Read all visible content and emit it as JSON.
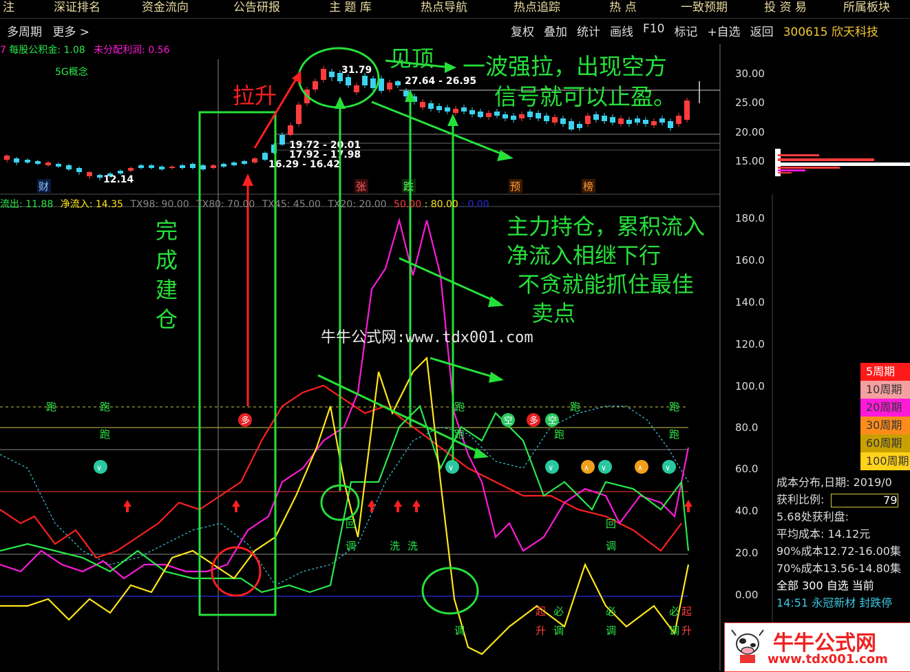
{
  "nav": [
    "注",
    "深证排名",
    "资金流向",
    "公告研报",
    "主 题 库",
    "热点导航",
    "热点追踪",
    "热  点",
    "一致预期",
    "投 资 易",
    "所属板块"
  ],
  "subbar": {
    "period": "多周期",
    "more": "更多 >",
    "tools": [
      "复权",
      "叠加",
      "统计",
      "画线",
      "F10",
      "标记",
      "+自选",
      "返回"
    ],
    "stock": "300615 欣天科技"
  },
  "info": {
    "reserve_label": "每股公积金: 1.08",
    "undist_label": "未分配利润: 0.56",
    "concept": "5G概念"
  },
  "price_axis": [
    "30.00",
    "25.00",
    "20.00",
    "15.00"
  ],
  "price_labels": {
    "high": "31.79",
    "range1": "27.64 - 26.95",
    "range2": "19.72 - 20.01",
    "range3": "17.92 - 17.98",
    "range4": "16.29 - 16.42",
    "low": "12.14"
  },
  "event_tags": [
    "财",
    "张",
    "跌",
    "预",
    "榜"
  ],
  "indicator_line": {
    "a": "流出: 11.88",
    "b": "净流入: 14.35",
    "c": "TX98: 90.00",
    "d": "TX80: 70.00",
    "e": "TX45: 45.00",
    "f": "TX20: 20.00",
    "g": "50.00",
    "h": ": 80.00",
    "i": ": 0.00"
  },
  "ind_axis": [
    "180.0",
    "160.0",
    "140.0",
    "120.0",
    "100.0",
    "80.0",
    "60.0",
    "40.0",
    "20.0",
    "0.00"
  ],
  "legend": [
    {
      "label": "5周期",
      "color": "#ff1a1a"
    },
    {
      "label": "10周期",
      "color": "#f4a0a0"
    },
    {
      "label": "20周期",
      "color": "#ff1ad9"
    },
    {
      "label": "30周期",
      "color": "#ff8c1a"
    },
    {
      "label": "60周期",
      "color": "#c8a000"
    },
    {
      "label": "100周期",
      "color": "#ffd21a"
    }
  ],
  "panel": {
    "title": "成本分布,日期: 2019/0",
    "ratio_label": "获利比例:",
    "ratio_value": "79",
    "line3": "5.68处获利盘:",
    "line4": "平均成本: 14.12元",
    "line5": "90%成本12.72-16.00集",
    "line6": "70%成本13.56-14.80集",
    "line7": "全部 300  自选 当前",
    "line8": "14:51  永冠新材  封跌停"
  },
  "annotations": {
    "lasheng": "拉升",
    "jianding": "见顶",
    "note1": "一波强拉，出现空方",
    "note2": "信号就可以止盈。",
    "jiancang": "完成建仓",
    "note3": "主力持仓，累积流入",
    "note4": "净流入相继下行",
    "note5": "不贪就能抓住最佳",
    "note6": "卖点"
  },
  "signals": {
    "pao": "跑",
    "duo": "多",
    "kong": "空",
    "hui": "回",
    "diao": "调",
    "xi": "洗",
    "qi": "起",
    "sheng": "升",
    "bi": "必"
  },
  "watermark": {
    "center": "牛牛公式网:www.tdx001.com",
    "title": "牛牛公式网",
    "url": "www.tdx001.com"
  },
  "colors": {
    "up": "#ff3c3c",
    "down": "#3cd2f0",
    "annotation": "#26e03a"
  }
}
